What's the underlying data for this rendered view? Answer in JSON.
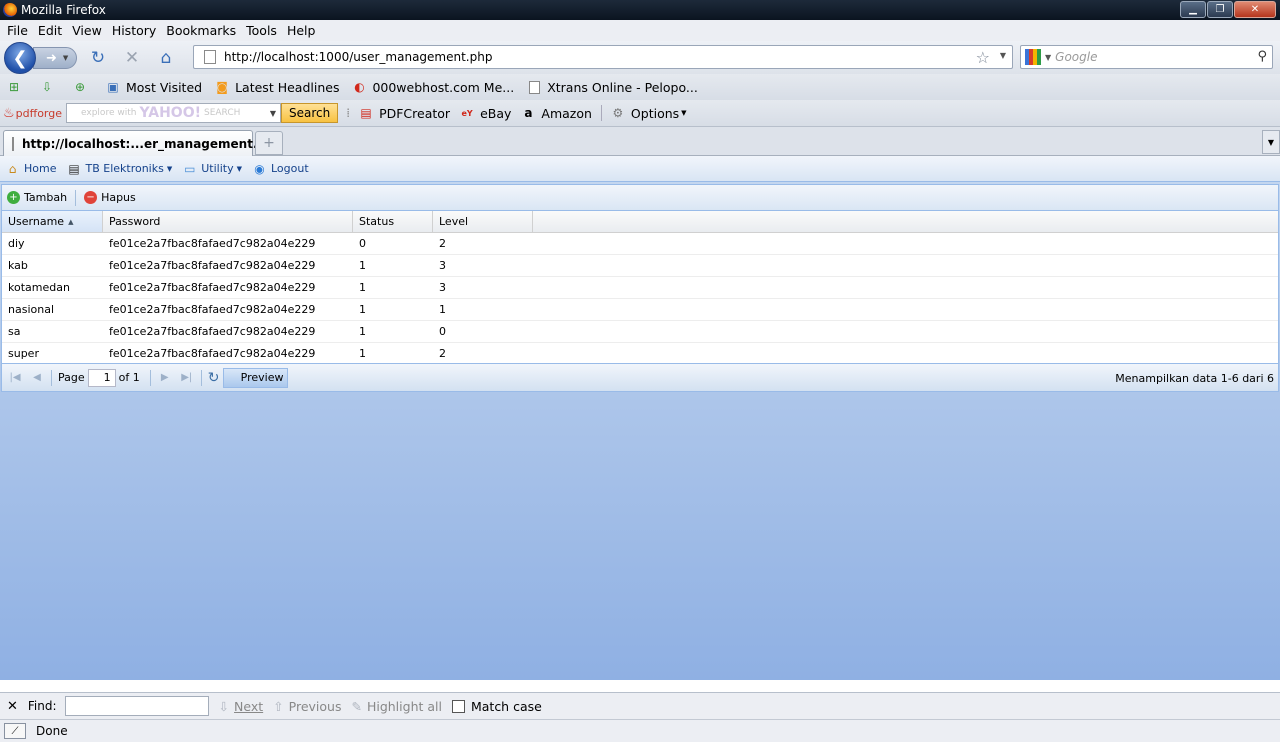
{
  "window": {
    "title": "Mozilla Firefox"
  },
  "menu": [
    "File",
    "Edit",
    "View",
    "History",
    "Bookmarks",
    "Tools",
    "Help"
  ],
  "nav": {
    "url": "http://localhost:1000/user_management.php",
    "search_placeholder": "Google"
  },
  "bookmarks": [
    {
      "label": "",
      "icon": "add-bookmark-icon"
    },
    {
      "label": "",
      "icon": "download-icon"
    },
    {
      "label": "",
      "icon": "add-page-icon"
    },
    {
      "label": "Most Visited",
      "icon": "most-visited-icon"
    },
    {
      "label": "Latest Headlines",
      "icon": "rss-icon"
    },
    {
      "label": "000webhost.com Me...",
      "icon": "webhost-icon"
    },
    {
      "label": "Xtrans Online - Pelopo...",
      "icon": "page-icon"
    }
  ],
  "toolbar2": {
    "brand": "pdfforge",
    "yahoo_placeholder": "explore with",
    "yahoo_brand": "YAHOO!",
    "yahoo_search": "SEARCH",
    "search_btn": "Search",
    "items": [
      "PDFCreator",
      "eBay",
      "Amazon",
      "Options"
    ]
  },
  "tab": {
    "title": "http://localhost:...er_management.php"
  },
  "app": {
    "menu": [
      {
        "label": "Home",
        "icon": "home-icon",
        "dropdown": false
      },
      {
        "label": "TB Elektroniks",
        "icon": "document-icon",
        "dropdown": true
      },
      {
        "label": "Utility",
        "icon": "folder-icon",
        "dropdown": true
      },
      {
        "label": "Logout",
        "icon": "logout-icon",
        "dropdown": false
      }
    ],
    "grid": {
      "actions": {
        "add": "Tambah",
        "delete": "Hapus"
      },
      "columns": [
        "Username",
        "Password",
        "Status",
        "Level"
      ],
      "rows": [
        [
          "diy",
          "fe01ce2a7fbac8fafaed7c982a04e229",
          "0",
          "2"
        ],
        [
          "kab",
          "fe01ce2a7fbac8fafaed7c982a04e229",
          "1",
          "3"
        ],
        [
          "kotamedan",
          "fe01ce2a7fbac8fafaed7c982a04e229",
          "1",
          "3"
        ],
        [
          "nasional",
          "fe01ce2a7fbac8fafaed7c982a04e229",
          "1",
          "1"
        ],
        [
          "sa",
          "fe01ce2a7fbac8fafaed7c982a04e229",
          "1",
          "0"
        ],
        [
          "super",
          "fe01ce2a7fbac8fafaed7c982a04e229",
          "1",
          "2"
        ]
      ],
      "pager": {
        "page_label": "Page",
        "page_value": "1",
        "of_label": "of 1",
        "preview": "Preview",
        "info": "Menampilkan data 1-6 dari 6"
      }
    }
  },
  "findbar": {
    "label": "Find:",
    "next": "Next",
    "previous": "Previous",
    "highlight": "Highlight all",
    "match_case": "Match case"
  },
  "status": {
    "text": "Done"
  }
}
